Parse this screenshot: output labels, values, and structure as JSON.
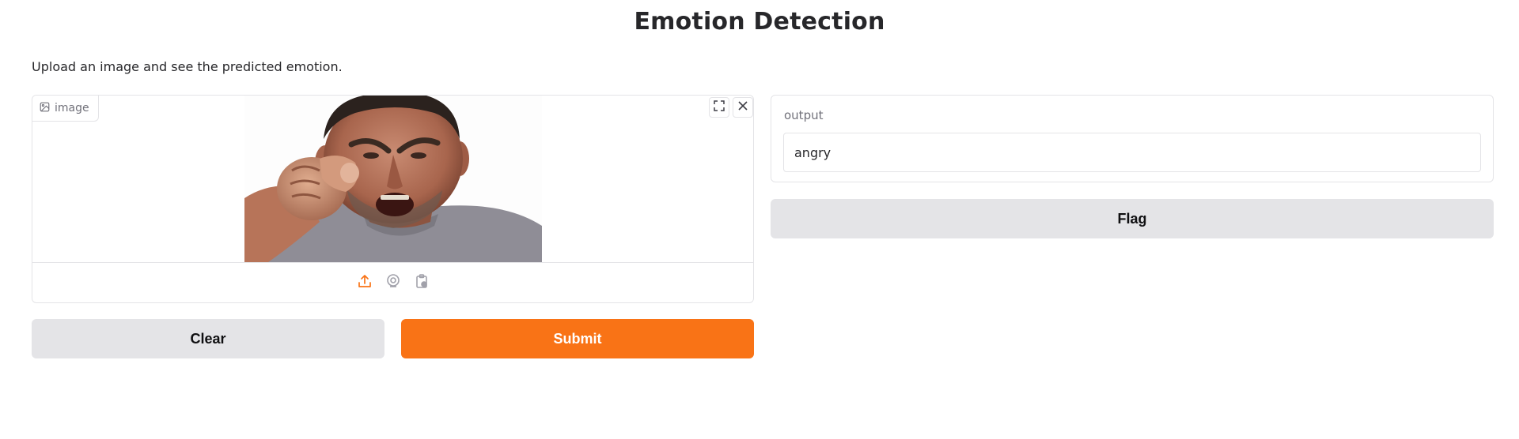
{
  "header": {
    "title": "Emotion Detection",
    "description": "Upload an image and see the predicted emotion."
  },
  "input": {
    "label": "image",
    "label_icon": "image-icon",
    "tools": [
      "fullscreen-icon",
      "close-icon"
    ],
    "sources": [
      "upload-icon",
      "webcam-icon",
      "clipboard-icon"
    ],
    "active_source_color": "#f97316"
  },
  "actions": {
    "clear_label": "Clear",
    "submit_label": "Submit",
    "flag_label": "Flag"
  },
  "output": {
    "label": "output",
    "value": "angry"
  },
  "colors": {
    "primary": "#f97316",
    "secondary": "#e4e4e7",
    "text": "#27272a",
    "muted": "#71717a",
    "border": "#e4e4e7"
  }
}
